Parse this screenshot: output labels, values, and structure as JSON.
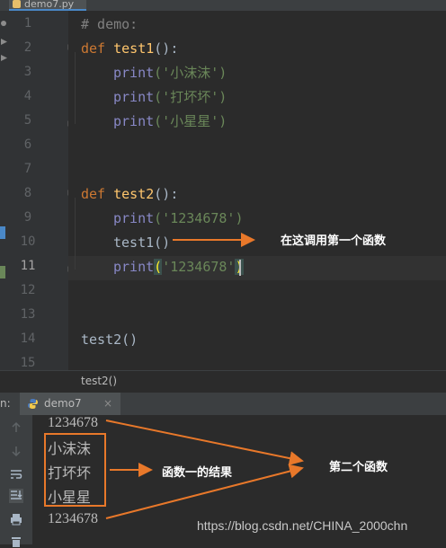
{
  "file_tab": {
    "label": "demo7.py"
  },
  "editor": {
    "line_numbers": [
      "1",
      "2",
      "3",
      "4",
      "5",
      "6",
      "7",
      "8",
      "9",
      "10",
      "11",
      "12",
      "13",
      "14",
      "15"
    ],
    "current_line": "11",
    "lines": {
      "l1": "# demo:",
      "l2_kw": "def",
      "l2_fn": "test1",
      "l2_rest": "():",
      "l3_bi": "print",
      "l3_str": "('小沫沫')",
      "l4_bi": "print",
      "l4_str": "('打坏坏')",
      "l5_bi": "print",
      "l5_str": "('小星星')",
      "l8_kw": "def",
      "l8_fn": "test2",
      "l8_rest": "():",
      "l9_bi": "print",
      "l9_str": "('1234678')",
      "l10": "test1()",
      "l11_bi": "print",
      "l11_open": "(",
      "l11_str": "'1234678'",
      "l11_close": ")",
      "l14": "test2()"
    }
  },
  "breadcrumb": {
    "text": "test2()"
  },
  "run_panel": {
    "label": "n:",
    "tab_label": "demo7",
    "tab_close": "×",
    "output": [
      "1234678",
      "小沫沫",
      "打坏坏",
      "小星星",
      "1234678"
    ]
  },
  "annotations": {
    "call_first": "在这调用第一个函数",
    "result_first": "函数一的结果",
    "second_function": "第二个函数",
    "color": "#e8782a"
  },
  "watermark": "https://blog.csdn.net/CHINA_2000chn"
}
